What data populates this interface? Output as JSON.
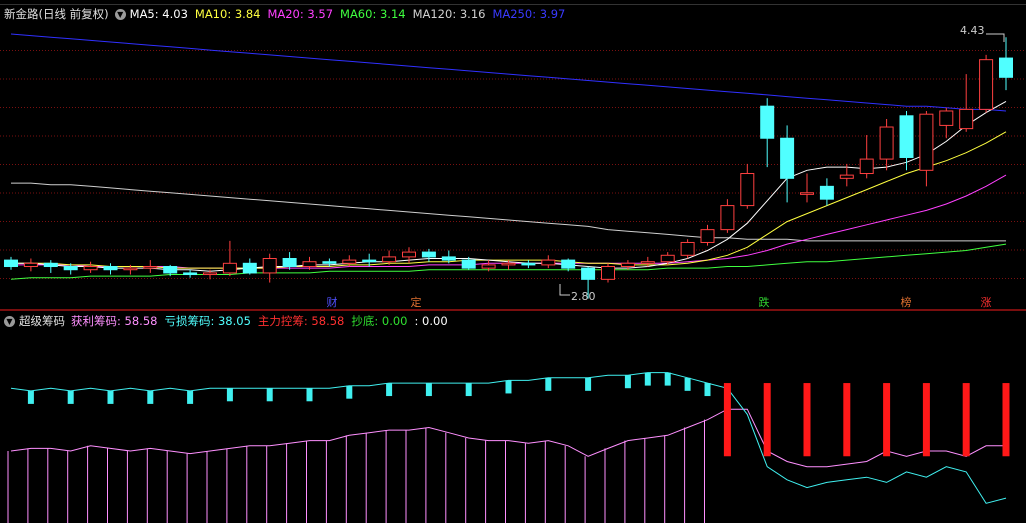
{
  "main_header": {
    "stock": "新金路(日线 前复权)",
    "ma": [
      {
        "label": "MA5: 4.03",
        "color": "#ffffff"
      },
      {
        "label": "MA10: 3.84",
        "color": "#ffff40"
      },
      {
        "label": "MA20: 3.57",
        "color": "#ff40ff"
      },
      {
        "label": "MA60: 3.14",
        "color": "#40ff40"
      },
      {
        "label": "MA120: 3.16",
        "color": "#d0d0d0"
      },
      {
        "label": "MA250: 3.97",
        "color": "#3a3aff"
      }
    ]
  },
  "price_annotations": {
    "high": "4.43",
    "low": "2.80"
  },
  "event_marks": [
    {
      "text": "财",
      "color": "#5050ff"
    },
    {
      "text": "定",
      "color": "#e07030"
    },
    {
      "text": "跌",
      "color": "#30d030"
    },
    {
      "text": "榜",
      "color": "#e07030"
    },
    {
      "text": "涨",
      "color": "#ff3030"
    }
  ],
  "indicator_header": {
    "name": "超级筹码",
    "items": [
      {
        "label": "获利筹码: 58.58",
        "color": "#ff90ff"
      },
      {
        "label": "亏损筹码: 38.05",
        "color": "#50ffff"
      },
      {
        "label": "主力控筹: 58.58",
        "color": "#ff3030"
      },
      {
        "label": "抄底: 0.00",
        "color": "#30e030"
      },
      {
        "label": ": 0.00",
        "color": "#ffffff"
      }
    ]
  },
  "colors": {
    "up": "#ff4040",
    "down": "#50ffff",
    "grid": "#7a1010",
    "ma250": "#3030ff"
  },
  "chart_data": {
    "type": "candlestick",
    "candles": [
      [
        3.04,
        3.0,
        3.06,
        2.98
      ],
      [
        3.0,
        3.02,
        3.05,
        2.97
      ],
      [
        3.02,
        3.0,
        3.04,
        2.96
      ],
      [
        3.0,
        2.98,
        3.02,
        2.95
      ],
      [
        2.98,
        3.0,
        3.03,
        2.96
      ],
      [
        3.0,
        2.98,
        3.02,
        2.95
      ],
      [
        2.98,
        2.99,
        3.01,
        2.95
      ],
      [
        2.99,
        3.0,
        3.04,
        2.96
      ],
      [
        3.0,
        2.96,
        3.01,
        2.94
      ],
      [
        2.96,
        2.95,
        2.98,
        2.93
      ],
      [
        2.95,
        2.96,
        2.98,
        2.92
      ],
      [
        2.96,
        3.02,
        3.16,
        2.94
      ],
      [
        3.02,
        2.96,
        3.05,
        2.95
      ],
      [
        2.96,
        3.05,
        3.08,
        2.9
      ],
      [
        3.05,
        3.0,
        3.09,
        2.98
      ],
      [
        3.0,
        3.03,
        3.06,
        2.98
      ],
      [
        3.03,
        3.02,
        3.05,
        3.0
      ],
      [
        3.02,
        3.04,
        3.07,
        3.0
      ],
      [
        3.04,
        3.03,
        3.08,
        3.0
      ],
      [
        3.03,
        3.06,
        3.1,
        3.01
      ],
      [
        3.06,
        3.09,
        3.12,
        3.02
      ],
      [
        3.09,
        3.06,
        3.11,
        3.03
      ],
      [
        3.06,
        3.04,
        3.1,
        3.02
      ],
      [
        3.04,
        2.99,
        3.06,
        2.98
      ],
      [
        2.99,
        3.01,
        3.04,
        2.97
      ],
      [
        3.01,
        3.02,
        3.04,
        2.98
      ],
      [
        3.02,
        3.01,
        3.04,
        2.99
      ],
      [
        3.01,
        3.04,
        3.07,
        2.99
      ],
      [
        3.04,
        2.99,
        3.05,
        2.97
      ],
      [
        2.99,
        2.92,
        3.0,
        2.8
      ],
      [
        2.92,
        3.0,
        3.02,
        2.9
      ],
      [
        3.0,
        3.02,
        3.04,
        2.98
      ],
      [
        3.02,
        3.03,
        3.06,
        3.0
      ],
      [
        3.03,
        3.07,
        3.09,
        3.01
      ],
      [
        3.07,
        3.15,
        3.17,
        3.05
      ],
      [
        3.15,
        3.23,
        3.26,
        3.13
      ],
      [
        3.23,
        3.38,
        3.42,
        3.21
      ],
      [
        3.38,
        3.58,
        3.64,
        3.36
      ],
      [
        4.0,
        3.8,
        4.05,
        3.62
      ],
      [
        3.8,
        3.55,
        3.88,
        3.4
      ],
      [
        3.45,
        3.46,
        3.58,
        3.4
      ],
      [
        3.5,
        3.42,
        3.55,
        3.38
      ],
      [
        3.55,
        3.57,
        3.64,
        3.5
      ],
      [
        3.58,
        3.67,
        3.82,
        3.55
      ],
      [
        3.67,
        3.87,
        3.92,
        3.6
      ],
      [
        3.94,
        3.68,
        3.97,
        3.6
      ],
      [
        3.6,
        3.95,
        3.97,
        3.5
      ],
      [
        3.88,
        3.97,
        3.99,
        3.8
      ],
      [
        3.86,
        3.98,
        4.2,
        3.84
      ],
      [
        3.98,
        4.29,
        4.32,
        3.96
      ],
      [
        4.3,
        4.18,
        4.43,
        4.1
      ]
    ],
    "ma5": [
      3.02,
      3.02,
      3.01,
      3.0,
      3.0,
      2.99,
      2.99,
      2.99,
      2.98,
      2.98,
      2.97,
      2.98,
      2.99,
      3.0,
      3.0,
      3.01,
      3.01,
      3.02,
      3.03,
      3.03,
      3.04,
      3.05,
      3.05,
      3.05,
      3.04,
      3.03,
      3.02,
      3.02,
      3.01,
      3.0,
      2.99,
      2.99,
      3.0,
      3.02,
      3.05,
      3.1,
      3.17,
      3.27,
      3.41,
      3.55,
      3.6,
      3.62,
      3.62,
      3.61,
      3.62,
      3.65,
      3.7,
      3.78,
      3.88,
      3.96,
      4.03
    ],
    "ma10": [
      3.02,
      3.02,
      3.02,
      3.01,
      3.01,
      3.0,
      3.0,
      3.0,
      2.99,
      2.99,
      2.99,
      2.99,
      2.99,
      2.99,
      3.0,
      3.0,
      3.0,
      3.01,
      3.01,
      3.02,
      3.02,
      3.03,
      3.03,
      3.04,
      3.04,
      3.04,
      3.04,
      3.04,
      3.03,
      3.02,
      3.02,
      3.01,
      3.01,
      3.01,
      3.02,
      3.04,
      3.07,
      3.12,
      3.2,
      3.28,
      3.33,
      3.38,
      3.43,
      3.48,
      3.53,
      3.58,
      3.62,
      3.66,
      3.71,
      3.77,
      3.84
    ],
    "ma20": [
      3.01,
      3.01,
      3.01,
      3.01,
      3.0,
      3.0,
      3.0,
      3.0,
      3.0,
      2.99,
      2.99,
      2.99,
      2.99,
      2.99,
      2.99,
      2.99,
      2.99,
      3.0,
      3.0,
      3.0,
      3.0,
      3.01,
      3.01,
      3.01,
      3.02,
      3.02,
      3.02,
      3.02,
      3.02,
      3.02,
      3.02,
      3.02,
      3.02,
      3.02,
      3.03,
      3.04,
      3.05,
      3.07,
      3.1,
      3.14,
      3.17,
      3.2,
      3.23,
      3.26,
      3.29,
      3.32,
      3.35,
      3.39,
      3.44,
      3.5,
      3.57
    ],
    "ma60": [
      2.92,
      2.93,
      2.93,
      2.93,
      2.94,
      2.94,
      2.94,
      2.94,
      2.95,
      2.95,
      2.95,
      2.95,
      2.96,
      2.96,
      2.96,
      2.96,
      2.97,
      2.97,
      2.97,
      2.97,
      2.97,
      2.98,
      2.98,
      2.98,
      2.98,
      2.98,
      2.98,
      2.98,
      2.98,
      2.98,
      2.98,
      2.98,
      2.98,
      2.99,
      2.99,
      2.99,
      3.0,
      3.0,
      3.01,
      3.02,
      3.03,
      3.03,
      3.04,
      3.05,
      3.06,
      3.07,
      3.08,
      3.09,
      3.1,
      3.12,
      3.14
    ],
    "ma120": [
      3.52,
      3.52,
      3.51,
      3.51,
      3.5,
      3.49,
      3.48,
      3.47,
      3.46,
      3.45,
      3.44,
      3.43,
      3.42,
      3.41,
      3.4,
      3.39,
      3.38,
      3.37,
      3.36,
      3.35,
      3.34,
      3.33,
      3.32,
      3.31,
      3.3,
      3.29,
      3.28,
      3.27,
      3.26,
      3.25,
      3.23,
      3.22,
      3.21,
      3.2,
      3.19,
      3.18,
      3.18,
      3.17,
      3.17,
      3.17,
      3.16,
      3.16,
      3.16,
      3.16,
      3.16,
      3.16,
      3.16,
      3.16,
      3.16,
      3.16,
      3.16
    ],
    "ma250": [
      4.45,
      4.44,
      4.43,
      4.42,
      4.41,
      4.4,
      4.39,
      4.38,
      4.37,
      4.36,
      4.35,
      4.34,
      4.33,
      4.32,
      4.31,
      4.3,
      4.29,
      4.28,
      4.27,
      4.26,
      4.25,
      4.24,
      4.23,
      4.22,
      4.21,
      4.2,
      4.19,
      4.18,
      4.17,
      4.16,
      4.15,
      4.14,
      4.13,
      4.12,
      4.11,
      4.1,
      4.09,
      4.08,
      4.07,
      4.06,
      4.05,
      4.04,
      4.03,
      4.02,
      4.01,
      4.0,
      4.0,
      3.99,
      3.98,
      3.98,
      3.97
    ],
    "profit_chips": [
      56,
      57,
      57,
      56,
      58,
      57,
      56,
      57,
      56,
      55,
      56,
      57,
      58,
      58,
      59,
      60,
      60,
      62,
      63,
      64,
      64,
      65,
      63,
      61,
      60,
      60,
      59,
      60,
      58,
      54,
      57,
      60,
      61,
      62,
      65,
      68,
      72,
      72,
      56,
      52,
      50,
      50,
      51,
      52,
      56,
      54,
      56,
      56,
      54,
      58,
      58
    ],
    "loss_chips": [
      80,
      79,
      80,
      79,
      80,
      79,
      80,
      79,
      80,
      79,
      80,
      80,
      80,
      80,
      80,
      80,
      80,
      81,
      81,
      82,
      82,
      82,
      82,
      82,
      82,
      83,
      83,
      84,
      84,
      84,
      85,
      85,
      86,
      86,
      84,
      82,
      80,
      70,
      50,
      45,
      42,
      44,
      45,
      46,
      44,
      48,
      46,
      50,
      48,
      36,
      38
    ],
    "main_control": [
      0,
      0,
      0,
      0,
      0,
      0,
      0,
      0,
      0,
      0,
      0,
      0,
      0,
      0,
      0,
      0,
      0,
      0,
      0,
      0,
      0,
      0,
      0,
      0,
      0,
      0,
      0,
      0,
      0,
      0,
      0,
      0,
      0,
      0,
      0,
      0,
      58,
      58,
      58,
      58,
      58,
      58,
      58,
      58,
      58,
      58,
      58,
      58,
      58,
      58,
      58
    ]
  }
}
